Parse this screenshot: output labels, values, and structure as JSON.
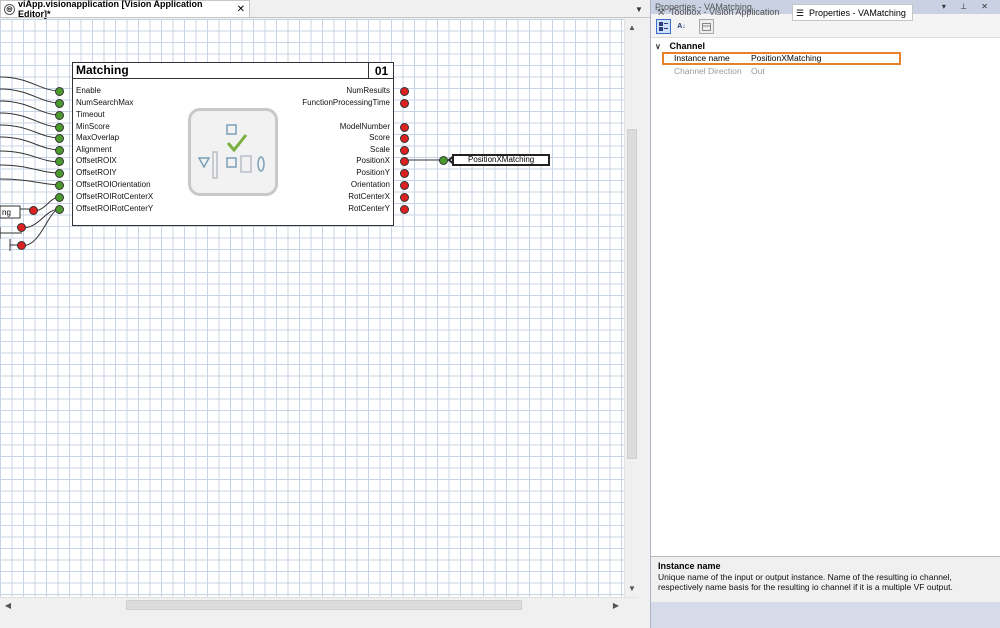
{
  "editor": {
    "tab_title": "viApp.visionapplication [Vision Application Editor]*",
    "close_glyph": "✕",
    "menu_glyph": "▼"
  },
  "block": {
    "title": "Matching",
    "id": "01",
    "inputs": [
      "Enable",
      "NumSearchMax",
      "Timeout",
      "MinScore",
      "MaxOverlap",
      "Alignment",
      "OffsetROIX",
      "OffsetROIY",
      "OffsetROIOrientation",
      "OffsetROIRotCenterX",
      "OffsetROIRotCenterY"
    ],
    "outputs": [
      "NumResults",
      "FunctionProcessingTime",
      "ModelNumber",
      "Score",
      "Scale",
      "PositionX",
      "PositionY",
      "Orientation",
      "RotCenterX",
      "RotCenterY"
    ]
  },
  "left_stub_label": "ng",
  "channel_tag": "PositionXMatching",
  "properties": {
    "panel_title": "Properties - VAMatching",
    "title_buttons": "▾ ⊥ ✕",
    "category": "Channel",
    "rows": [
      {
        "name": "Instance name",
        "value": "PositionXMatching"
      },
      {
        "name": "Channel Direction",
        "value": "Out"
      }
    ],
    "description_title": "Instance name",
    "description_text": "Unique name of the input or output instance. Name of the resulting io channel, respectively name basis for the resulting io channel if it is a multiple VF output."
  },
  "bottom_tabs": {
    "toolbox": "Toolbox - Vision Application",
    "properties": "Properties - VAMatching"
  },
  "icons": {
    "editor_tab": "vision-app-icon",
    "categorized": "categorized-icon",
    "alphabetical": "alphabetical-sort-icon",
    "property_pages": "property-pages-icon",
    "toolbox": "toolbox-icon",
    "properties": "properties-icon"
  }
}
